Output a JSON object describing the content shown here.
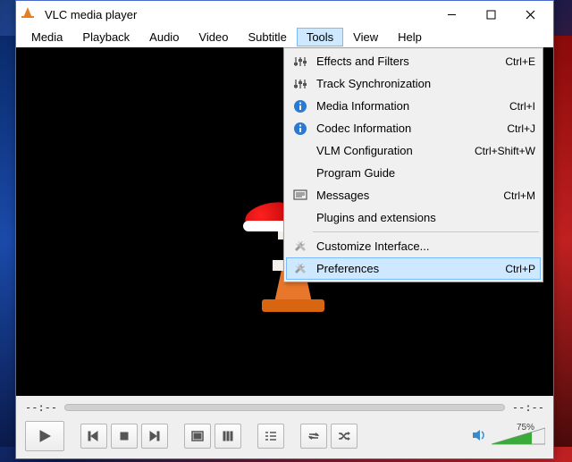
{
  "title": "VLC media player",
  "menubar": [
    "Media",
    "Playback",
    "Audio",
    "Video",
    "Subtitle",
    "Tools",
    "View",
    "Help"
  ],
  "menubar_open_index": 5,
  "dropdown": [
    {
      "icon": "equalizer",
      "label": "Effects and Filters",
      "shortcut": "Ctrl+E"
    },
    {
      "icon": "equalizer",
      "label": "Track Synchronization",
      "shortcut": ""
    },
    {
      "icon": "info",
      "label": "Media Information",
      "shortcut": "Ctrl+I"
    },
    {
      "icon": "info",
      "label": "Codec Information",
      "shortcut": "Ctrl+J"
    },
    {
      "icon": "",
      "label": "VLM Configuration",
      "shortcut": "Ctrl+Shift+W"
    },
    {
      "icon": "",
      "label": "Program Guide",
      "shortcut": ""
    },
    {
      "icon": "messages",
      "label": "Messages",
      "shortcut": "Ctrl+M"
    },
    {
      "icon": "",
      "label": "Plugins and extensions",
      "shortcut": ""
    },
    {
      "sep": true
    },
    {
      "icon": "wrench",
      "label": "Customize Interface...",
      "shortcut": ""
    },
    {
      "icon": "wrench",
      "label": "Preferences",
      "shortcut": "Ctrl+P",
      "hover": true
    }
  ],
  "time_elapsed": "--:--",
  "time_total": "--:--",
  "volume_percent": "75%"
}
